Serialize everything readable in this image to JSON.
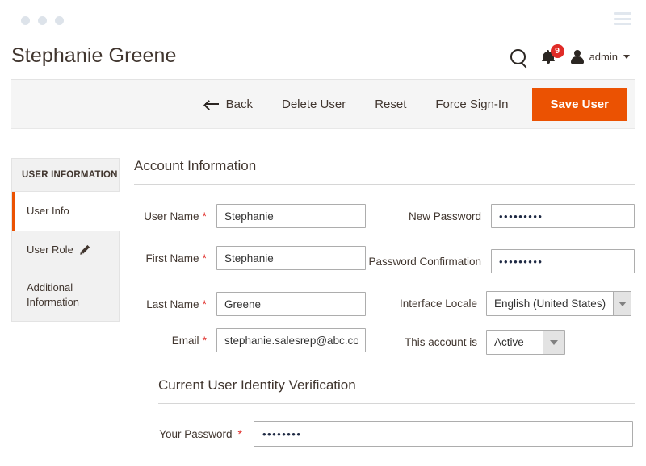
{
  "window": {
    "dots": [
      "dot-1",
      "dot-2",
      "dot-3"
    ],
    "menu_icon": "hamburger-menu-icon"
  },
  "header": {
    "title": "Stephanie Greene",
    "search_icon": "search-icon",
    "notifications": {
      "icon": "bell-icon",
      "count": "9",
      "badge_color": "#e02b27"
    },
    "account": {
      "avatar_icon": "user-avatar-icon",
      "label": "admin",
      "caret_icon": "chevron-down-icon"
    }
  },
  "toolbar": {
    "back_label": "Back",
    "back_icon": "arrow-left-icon",
    "delete_label": "Delete User",
    "reset_label": "Reset",
    "force_signin_label": "Force Sign-In",
    "save_label": "Save User",
    "save_color": "#eb5202"
  },
  "sidebar": {
    "title": "USER INFORMATION",
    "items": [
      {
        "label": "User Info",
        "active": true,
        "icon": null
      },
      {
        "label": "User Role",
        "active": false,
        "icon": "pencil-icon"
      },
      {
        "label": "Additional Information",
        "active": false,
        "icon": null
      }
    ]
  },
  "account_section": {
    "heading": "Account Information",
    "left_fields": [
      {
        "label": "User Name",
        "required": true,
        "value": "Stephanie"
      },
      {
        "label": "First Name",
        "required": true,
        "value": "Stephanie"
      },
      {
        "label": "Last Name",
        "required": true,
        "value": "Greene"
      },
      {
        "label": "Email",
        "required": true,
        "value": "stephanie.salesrep@abc.com"
      }
    ],
    "right_fields": [
      {
        "label": "New Password",
        "required": false,
        "type": "password",
        "value": "•••••••••"
      },
      {
        "label": "Password Confirmation",
        "required": false,
        "type": "password",
        "value": "•••••••••"
      },
      {
        "label": "Interface Locale",
        "required": false,
        "type": "select",
        "value": "English (United States)"
      },
      {
        "label": "This account is",
        "required": false,
        "type": "select",
        "value": "Active"
      }
    ]
  },
  "verification_section": {
    "heading": "Current User Identity Verification",
    "password_label": "Your Password",
    "password_required": true,
    "password_value": "••••••••"
  }
}
